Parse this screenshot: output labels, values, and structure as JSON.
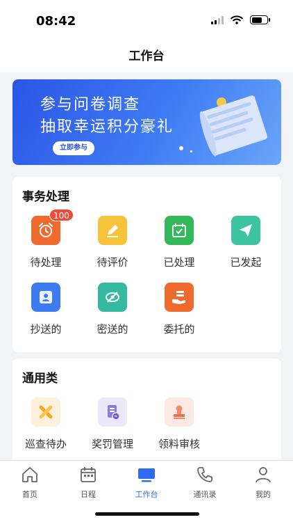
{
  "status": {
    "time": "08:42"
  },
  "header": {
    "title": "工作台"
  },
  "banner": {
    "line1": "参与问卷调查",
    "line2": "抽取幸运积分豪礼",
    "button": "立即参与"
  },
  "affairs": {
    "title": "事务处理",
    "items": [
      {
        "label": "待处理",
        "icon": "alarm-clock-icon",
        "color": "#ee6a2d",
        "badge": "100"
      },
      {
        "label": "待评价",
        "icon": "edit-pencil-icon",
        "color": "#f6c43a"
      },
      {
        "label": "已处理",
        "icon": "calendar-check-icon",
        "color": "#34b95a"
      },
      {
        "label": "已发起",
        "icon": "paper-plane-icon",
        "color": "#3cc3a0"
      },
      {
        "label": "抄送的",
        "icon": "contact-forward-icon",
        "color": "#3d7cf0"
      },
      {
        "label": "密送的",
        "icon": "eye-hidden-icon",
        "color": "#35b9a0"
      },
      {
        "label": "委托的",
        "icon": "hand-delegate-icon",
        "color": "#ee6a2d"
      }
    ]
  },
  "general": {
    "title": "通用类",
    "items": [
      {
        "label": "巡查待办",
        "icon": "tools-cross-icon",
        "color": "#fdf1dc"
      },
      {
        "label": "奖罚管理",
        "icon": "document-coin-icon",
        "color": "#ece8fb"
      },
      {
        "label": "领料审核",
        "icon": "stamp-icon",
        "color": "#fde9e4"
      }
    ]
  },
  "tabs": [
    {
      "label": "首页",
      "icon": "home-icon"
    },
    {
      "label": "日程",
      "icon": "calendar-icon"
    },
    {
      "label": "工作台",
      "icon": "monitor-icon",
      "active": true
    },
    {
      "label": "通讯录",
      "icon": "phone-icon"
    },
    {
      "label": "我的",
      "icon": "user-icon"
    }
  ]
}
